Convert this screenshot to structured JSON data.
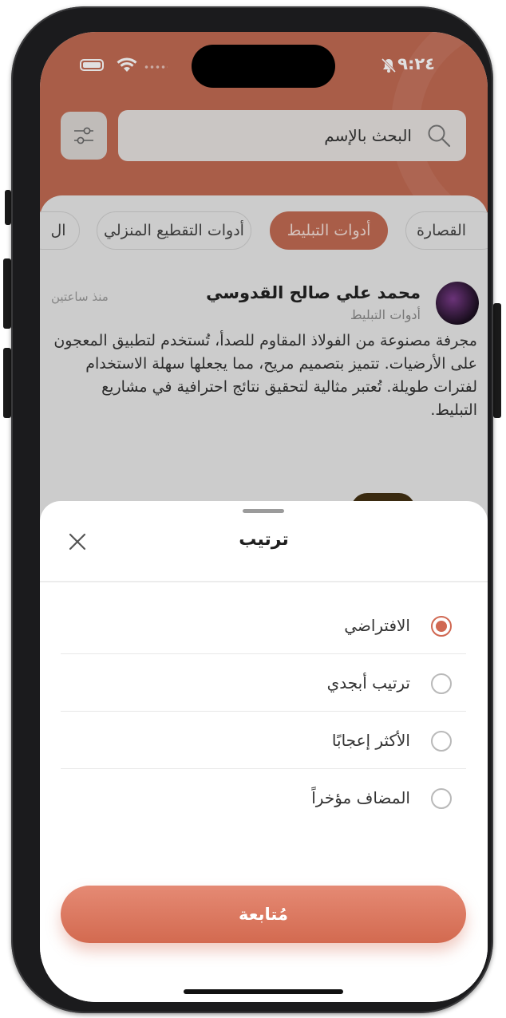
{
  "status_bar": {
    "time": "٩:٢٤"
  },
  "search": {
    "placeholder": "البحث بالإسم"
  },
  "chips": [
    {
      "label": "القصارة",
      "active": false
    },
    {
      "label": "أدوات التبليط",
      "active": true
    },
    {
      "label": "أدوات التقطيع المنزلي",
      "active": false
    },
    {
      "label": "ال",
      "active": false
    }
  ],
  "post": {
    "author": "محمد علي صالح القدوسي",
    "category": "أدوات التبليط",
    "time_ago": "منذ ساعتين",
    "body": "مجرفة مصنوعة من الفولاذ المقاوم للصدأ، تُستخدم لتطبيق المعجون على الأرضيات. تتميز بتصميم مريح، مما يجعلها سهلة الاستخدام لفترات طويلة. تُعتبر مثالية لتحقيق نتائج احترافية في مشاريع التبليط."
  },
  "sheet": {
    "title": "ترتيب",
    "options": [
      {
        "label": "الافتراضي",
        "selected": true
      },
      {
        "label": "ترتيب أبجدي",
        "selected": false
      },
      {
        "label": "الأكثر إعجابًا",
        "selected": false
      },
      {
        "label": "المضاف مؤخراً",
        "selected": false
      }
    ],
    "continue_label": "مُتابعة"
  },
  "colors": {
    "accent": "#d06852",
    "header": "#c16a52"
  }
}
